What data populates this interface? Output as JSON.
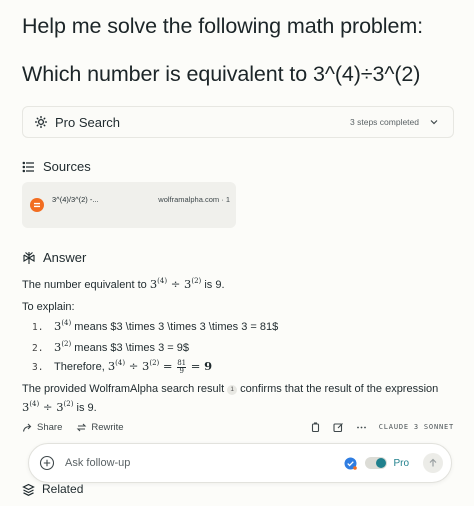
{
  "question": {
    "line1": "Help me solve the following math problem:",
    "line2": "Which number is equivalent to 3^(4)÷3^(2)"
  },
  "pro_search": {
    "label": "Pro Search",
    "steps": "3 steps completed"
  },
  "sources": {
    "heading": "Sources",
    "items": [
      {
        "title": "3^(4)/3^(2) -...",
        "site": "wolframalpha.com · 1"
      }
    ]
  },
  "answer": {
    "heading": "Answer",
    "intro_pre": "The number equivalent to ",
    "intro_post": " is 9.",
    "explain_label": "To explain:",
    "list": [
      {
        "num": "1.",
        "text": " means $3 \\times 3 \\times 3 \\times 3 = 81$"
      },
      {
        "num": "2.",
        "text": " means $3 \\times 3 = 9$"
      },
      {
        "num": "3.",
        "pre": "Therefore, "
      }
    ],
    "closing_pre": "The provided WolframAlpha search result",
    "citation": "1",
    "closing_post": "confirms that the result of the expression",
    "closing_end": " is 9."
  },
  "math": {
    "base": "3",
    "exp4": "(4)",
    "exp2": "(2)",
    "div": " ÷ ",
    "eq": " = ",
    "frac_num": "81",
    "frac_den": "9",
    "result": "9"
  },
  "toolbar": {
    "share": "Share",
    "rewrite": "Rewrite",
    "model": "CLAUDE 3 SONNET"
  },
  "followup": {
    "placeholder": "Ask follow-up",
    "pro_label": "Pro"
  },
  "related": {
    "heading": "Related"
  },
  "colors": {
    "accent": "#20808d",
    "favicon": "#f26d21",
    "check": "#2f7de1"
  }
}
